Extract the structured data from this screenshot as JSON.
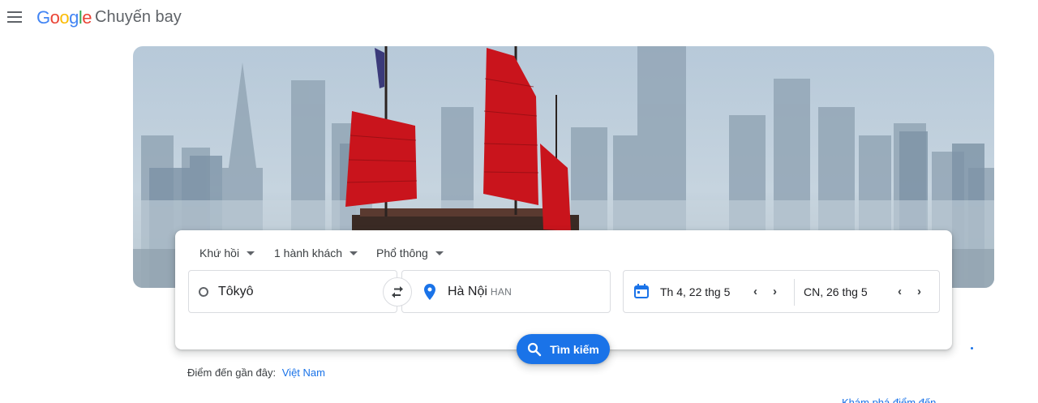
{
  "header": {
    "logo_letters": [
      "G",
      "o",
      "o",
      "g",
      "l",
      "e"
    ],
    "product": "Chuyến bay"
  },
  "filters": {
    "trip_type": "Khứ hồi",
    "passengers": "1 hành khách",
    "cabin_class": "Phổ thông"
  },
  "route": {
    "origin": "Tôkyô",
    "destination": "Hà Nội",
    "destination_code": "HAN"
  },
  "dates": {
    "depart": "Th 4, 22 thg 5",
    "return": "CN, 26 thg 5"
  },
  "search_button": "Tìm kiếm",
  "recent": {
    "label": "Điểm đến gần đây:",
    "link": "Việt Nam"
  },
  "explore_link": "Khám phá điểm đến",
  "colors": {
    "accent": "#1a73e8",
    "sail_red": "#c9141c"
  },
  "icons": [
    "menu-icon",
    "swap-icon",
    "location-pin-icon",
    "calendar-icon",
    "search-icon",
    "chevron-left-icon",
    "chevron-right-icon"
  ]
}
